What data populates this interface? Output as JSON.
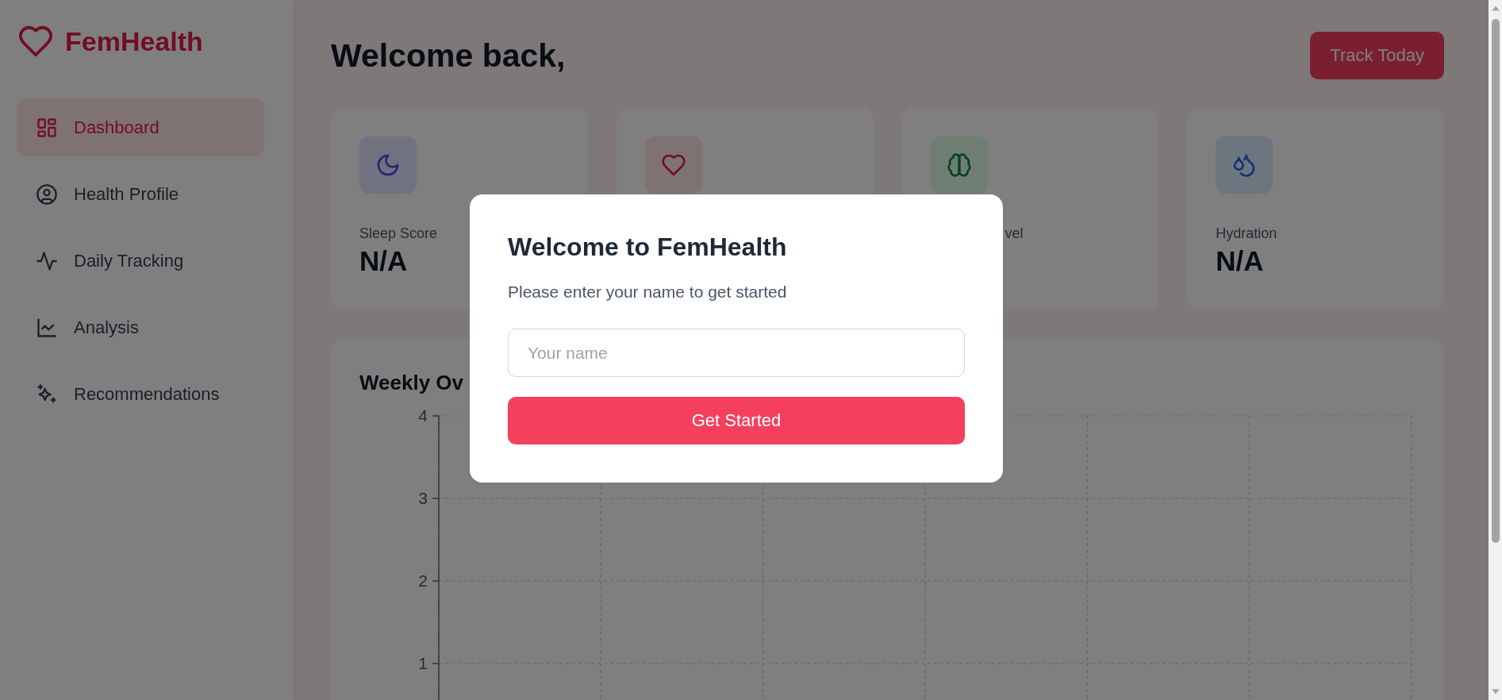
{
  "brand": {
    "name": "FemHealth"
  },
  "sidebar": {
    "items": [
      {
        "kind": "dashboard",
        "label": "Dashboard",
        "selected": true
      },
      {
        "kind": "profile",
        "label": "Health Profile",
        "selected": false
      },
      {
        "kind": "tracking",
        "label": "Daily Tracking",
        "selected": false
      },
      {
        "kind": "analysis",
        "label": "Analysis",
        "selected": false
      },
      {
        "kind": "recommendations",
        "label": "Recommendations",
        "selected": false
      }
    ]
  },
  "header": {
    "title": "Welcome back,",
    "button": "Track Today"
  },
  "cards": [
    {
      "kind": "sleep",
      "label": "Sleep Score",
      "value": "N/A"
    },
    {
      "kind": "heart"
    },
    {
      "kind": "brain",
      "label": "vel",
      "partly_covered": true
    },
    {
      "kind": "hydration",
      "label": "Hydration",
      "value": "N/A"
    }
  ],
  "weekly": {
    "title": "Weekly Ov",
    "y_axis_labels": [
      "4",
      "3",
      "2",
      "1"
    ]
  },
  "modal": {
    "title": "Welcome to FemHealth",
    "text": "Please enter your name to get started",
    "input": {
      "placeholder": "Your name"
    },
    "button": "Get Started"
  }
}
